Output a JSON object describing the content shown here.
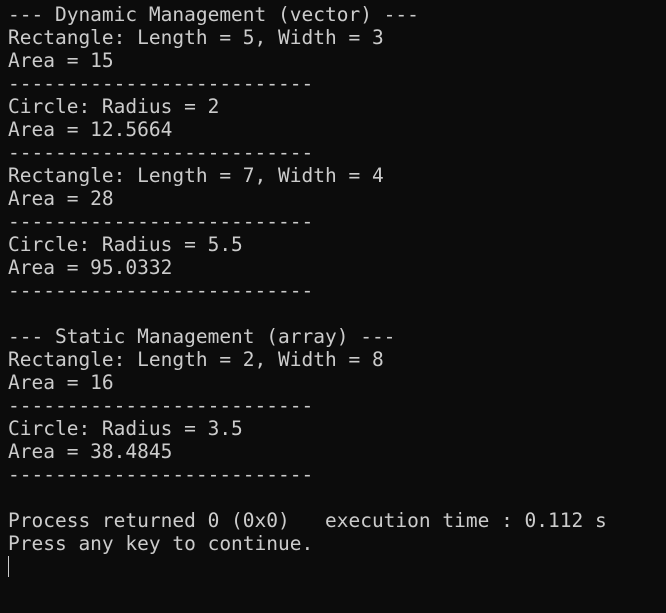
{
  "console": {
    "lines": [
      "--- Dynamic Management (vector) ---",
      "Rectangle: Length = 5, Width = 3",
      "Area = 15",
      "--------------------------",
      "Circle: Radius = 2",
      "Area = 12.5664",
      "--------------------------",
      "Rectangle: Length = 7, Width = 4",
      "Area = 28",
      "--------------------------",
      "Circle: Radius = 5.5",
      "Area = 95.0332",
      "--------------------------",
      "",
      "--- Static Management (array) ---",
      "Rectangle: Length = 2, Width = 8",
      "Area = 16",
      "--------------------------",
      "Circle: Radius = 3.5",
      "Area = 38.4845",
      "--------------------------",
      "",
      "Process returned 0 (0x0)   execution time : 0.112 s",
      "Press any key to continue."
    ]
  },
  "colors": {
    "background": "#0c0c0c",
    "text": "#cccccc"
  }
}
